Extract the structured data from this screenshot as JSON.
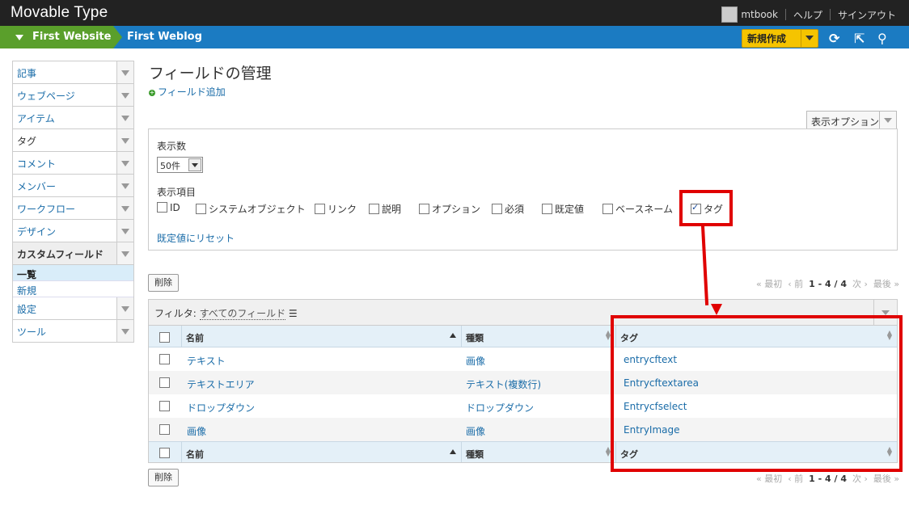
{
  "app": {
    "title": "Movable Type"
  },
  "user": {
    "name": "mtbook",
    "help": "ヘルプ",
    "signout": "サインアウト"
  },
  "nav": {
    "website": "First Website",
    "blog": "First Weblog",
    "new_button": "新規作成"
  },
  "sidebar": {
    "items": [
      {
        "label": "記事"
      },
      {
        "label": "ウェブページ"
      },
      {
        "label": "アイテム"
      },
      {
        "label": "タグ"
      },
      {
        "label": "コメント"
      },
      {
        "label": "メンバー"
      },
      {
        "label": "ワークフロー"
      },
      {
        "label": "デザイン"
      },
      {
        "label": "カスタムフィールド"
      }
    ],
    "sub": [
      {
        "label": "一覧"
      },
      {
        "label": "新規"
      }
    ],
    "items2": [
      {
        "label": "設定"
      },
      {
        "label": "ツール"
      }
    ]
  },
  "page": {
    "title": "フィールドの管理",
    "add_field": "フィールド追加",
    "display_options": "表示オプション"
  },
  "options": {
    "per_page_label": "表示数",
    "per_page_value": "50件",
    "columns_label": "表示項目",
    "columns": [
      {
        "label": "ID",
        "checked": false
      },
      {
        "label": "システムオブジェクト",
        "checked": false
      },
      {
        "label": "リンク",
        "checked": false
      },
      {
        "label": "説明",
        "checked": false
      },
      {
        "label": "オプション",
        "checked": false
      },
      {
        "label": "必須",
        "checked": false
      },
      {
        "label": "既定値",
        "checked": false
      },
      {
        "label": "ベースネーム",
        "checked": false
      },
      {
        "label": "タグ",
        "checked": true
      }
    ],
    "reset": "既定値にリセット"
  },
  "list": {
    "delete_label": "削除",
    "pager": {
      "first": "« 最初",
      "prev": "‹ 前",
      "range": "1 - 4 / 4",
      "next": "次 ›",
      "last": "最後 »"
    },
    "filter_label": "フィルタ:",
    "filter_value": "すべてのフィールド",
    "headers": {
      "name": "名前",
      "type": "種類",
      "tag": "タグ"
    },
    "rows": [
      {
        "name": "テキスト",
        "type": "画像",
        "tag": "entrycftext"
      },
      {
        "name": "テキストエリア",
        "type": "テキスト(複数行)",
        "tag": "Entrycftextarea"
      },
      {
        "name": "ドロップダウン",
        "type": "ドロップダウン",
        "tag": "Entrycfselect"
      },
      {
        "name": "画像",
        "type": "画像",
        "tag": "EntryImage"
      }
    ]
  },
  "colors": {
    "nav_blue": "#1b7bc2",
    "site_green": "#5a9f2b",
    "new_yellow": "#f5c400",
    "highlight_red": "#e00000"
  }
}
